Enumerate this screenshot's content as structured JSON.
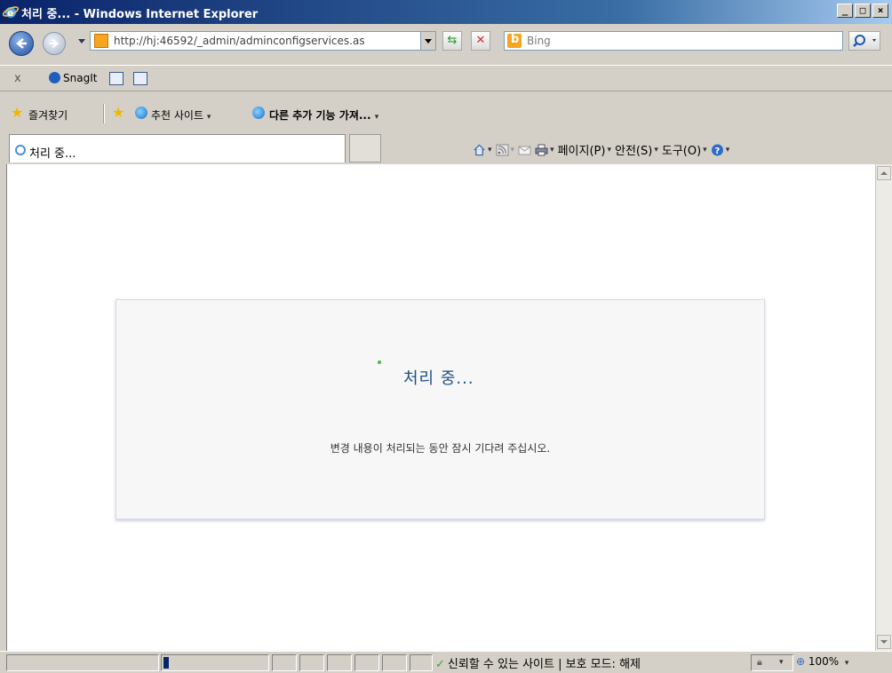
{
  "window": {
    "title": "처리 중... - Windows Internet Explorer",
    "controls": [
      "_",
      "□",
      "×"
    ]
  },
  "address_bar": {
    "url": "http://hj:46592/_admin/adminconfigservices.as",
    "search_placeholder": "Bing"
  },
  "toolbar": {
    "snagit_label": "SnagIt"
  },
  "favorites_bar": {
    "favorites_label": "즐겨찾기",
    "suggested_sites_label": "추천 사이트",
    "get_more_addons_label": "다른 추가 기능 가져..."
  },
  "tab": {
    "label": "처리 중..."
  },
  "command_bar": {
    "page_label": "페이지(P)",
    "safety_label": "안전(S)",
    "tools_label": "도구(O)"
  },
  "dialog": {
    "heading": "처리 중...",
    "message": "변경 내용이 처리되는 동안 잠시 기다려 주십시오."
  },
  "status_bar": {
    "zone_text": "신뢰할 수 있는 사이트 | 보호 모드: 해제",
    "zoom": "100%",
    "progress_fraction": 0.05
  },
  "colors": {
    "title_bar": "#0a246a",
    "dialog_heading": "#1f4f86",
    "spinner": "#4db848"
  }
}
